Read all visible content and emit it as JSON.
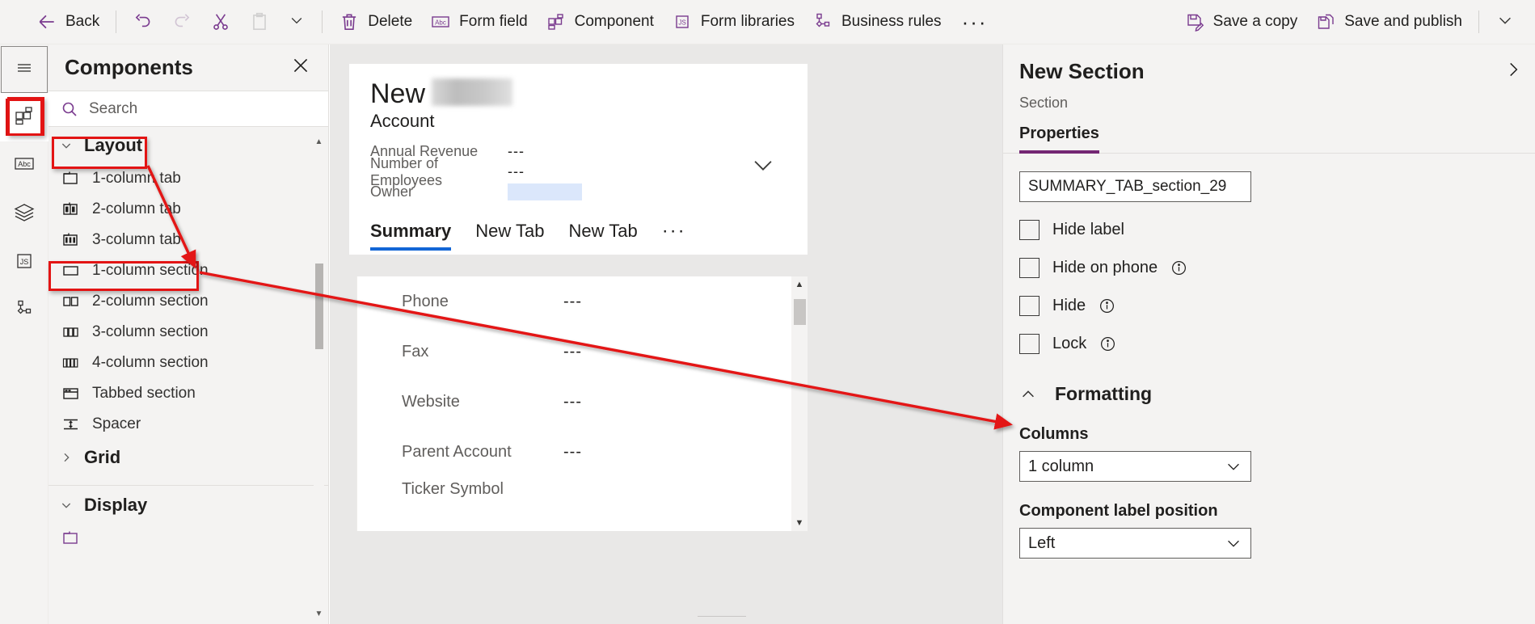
{
  "commandbar": {
    "back_label": "Back",
    "undo_icon": "undo-icon",
    "redo_icon": "redo-icon",
    "cut_icon": "cut-icon",
    "paste_icon": "paste-icon",
    "overflow_chevron_icon": "chevron-down-icon",
    "delete_label": "Delete",
    "form_field_label": "Form field",
    "component_label": "Component",
    "form_libraries_label": "Form libraries",
    "business_rules_label": "Business rules",
    "more_label": "···",
    "save_copy_label": "Save a copy",
    "save_publish_label": "Save and publish",
    "end_chevron_icon": "chevron-down-icon"
  },
  "rail": {
    "items": [
      {
        "icon": "hamburger-menu-icon",
        "name": "menu-toggle"
      },
      {
        "icon": "components-grid-icon",
        "name": "components"
      },
      {
        "icon": "abc-text-icon",
        "name": "form-fields"
      },
      {
        "icon": "layers-icon",
        "name": "tree-view"
      },
      {
        "icon": "js-script-icon",
        "name": "form-libraries"
      },
      {
        "icon": "business-rules-icon",
        "name": "business-rules"
      }
    ],
    "selected_index": 1
  },
  "components_panel": {
    "title": "Components",
    "close_icon": "close-icon",
    "search": {
      "placeholder": "Search",
      "value": "",
      "icon": "search-icon"
    },
    "groups": [
      {
        "label": "Layout",
        "expanded": true,
        "chevron": "chevron-down-icon",
        "items": [
          {
            "label": "1-column tab",
            "icon": "one-column-tab-icon"
          },
          {
            "label": "2-column tab",
            "icon": "two-column-tab-icon"
          },
          {
            "label": "3-column tab",
            "icon": "three-column-tab-icon"
          },
          {
            "label": "1-column section",
            "icon": "one-column-section-icon",
            "highlighted": true
          },
          {
            "label": "2-column section",
            "icon": "two-column-section-icon"
          },
          {
            "label": "3-column section",
            "icon": "three-column-section-icon"
          },
          {
            "label": "4-column section",
            "icon": "four-column-section-icon"
          },
          {
            "label": "Tabbed section",
            "icon": "tabbed-section-icon"
          },
          {
            "label": "Spacer",
            "icon": "spacer-icon"
          }
        ]
      },
      {
        "label": "Grid",
        "expanded": false,
        "chevron": "chevron-right-icon",
        "items": []
      },
      {
        "label": "Display",
        "expanded": true,
        "chevron": "chevron-down-icon",
        "items": []
      }
    ]
  },
  "canvas": {
    "form": {
      "title": "New",
      "title_redacted": true,
      "subtitle": "Account",
      "expand_icon": "chevron-down-icon",
      "header_fields": [
        {
          "label": "Annual Revenue",
          "value": "---"
        },
        {
          "label": "Number of Employees",
          "value": "---"
        },
        {
          "label": "Owner",
          "value": "",
          "redacted": true
        }
      ],
      "tabs": [
        {
          "label": "Summary",
          "active": true
        },
        {
          "label": "New Tab",
          "active": false
        },
        {
          "label": "New Tab",
          "active": false
        }
      ],
      "tabs_more": "···",
      "body_fields": [
        {
          "label": "Phone",
          "value": "---"
        },
        {
          "label": "Fax",
          "value": "---"
        },
        {
          "label": "Website",
          "value": "---"
        },
        {
          "label": "Parent Account",
          "value": "---"
        },
        {
          "label": "Ticker Symbol",
          "value": ""
        }
      ]
    }
  },
  "properties": {
    "title": "New Section",
    "subtitle": "Section",
    "expand_icon": "chevron-right-icon",
    "tabs": [
      {
        "label": "Properties",
        "active": true
      }
    ],
    "name_input": {
      "value": "SUMMARY_TAB_section_29"
    },
    "checkboxes": [
      {
        "label": "Hide label",
        "checked": false,
        "info": false
      },
      {
        "label": "Hide on phone",
        "checked": false,
        "info": true
      },
      {
        "label": "Hide",
        "checked": false,
        "info": true
      },
      {
        "label": "Lock",
        "checked": false,
        "info": true
      }
    ],
    "formatting": {
      "title": "Formatting",
      "expanded": true,
      "chevron": "chevron-up-icon",
      "columns": {
        "label": "Columns",
        "value": "1 column",
        "chevron": "chevron-down-icon"
      },
      "label_position": {
        "label": "Component label position",
        "value": "Left",
        "chevron": "chevron-down-icon"
      }
    }
  },
  "annotations": {
    "accent_color": "#e31414",
    "boxes": [
      "components-rail-icon",
      "layout-group-header",
      "one-column-section-item"
    ],
    "arrows": [
      "layout-to-one-column-section",
      "one-column-section-to-columns-dropdown"
    ]
  }
}
